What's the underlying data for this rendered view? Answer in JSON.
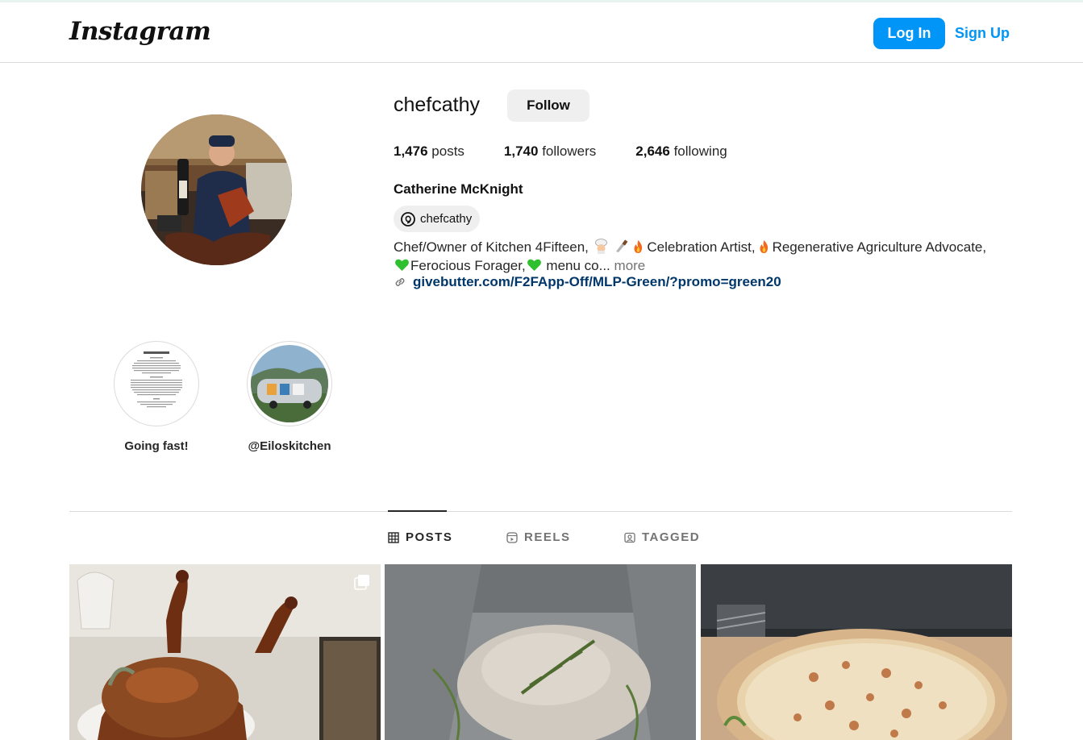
{
  "header": {
    "logo": "Instagram",
    "login_label": "Log In",
    "signup_label": "Sign Up"
  },
  "profile": {
    "username": "chefcathy",
    "follow_label": "Follow",
    "stats": {
      "posts_count": "1,476",
      "posts_label": "posts",
      "followers_count": "1,740",
      "followers_label": "followers",
      "following_count": "2,646",
      "following_label": "following"
    },
    "full_name": "Catherine McKnight",
    "threads_handle": "chefcathy",
    "bio": {
      "seg1": "Chef/Owner of Kitchen 4Fifteen,",
      "seg2": "Celebration Artist,",
      "seg3": "Regenerative Agriculture Advocate,",
      "seg4": "Ferocious Forager,",
      "seg5": " menu co...",
      "more_label": "more"
    },
    "link": "givebutter.com/F2FApp-Off/MLP-Green/?promo=green20"
  },
  "highlights": [
    {
      "label": "Going fast!"
    },
    {
      "label": "@Eiloskitchen"
    }
  ],
  "tabs": [
    {
      "label": "POSTS",
      "icon": "grid-icon",
      "active": true
    },
    {
      "label": "REELS",
      "icon": "reels-icon",
      "active": false
    },
    {
      "label": "TAGGED",
      "icon": "tagged-icon",
      "active": false
    }
  ],
  "colors": {
    "accent": "#0095f6",
    "link": "#00376b",
    "muted": "#737373"
  }
}
